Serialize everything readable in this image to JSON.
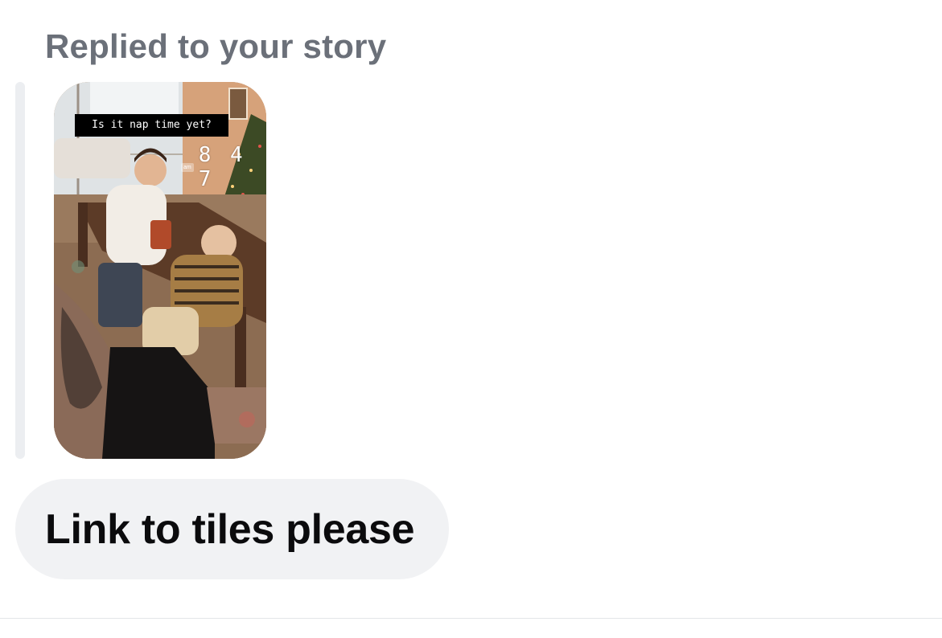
{
  "reply": {
    "header": "Replied to your story"
  },
  "story": {
    "caption": "Is it nap time yet?",
    "clock": {
      "period": "am",
      "time": "8 4 7"
    }
  },
  "message": {
    "text": "Link to tiles please"
  },
  "colors": {
    "header_text": "#6b7079",
    "bubble_bg": "#f1f2f4",
    "bubble_text": "#0b0b0d",
    "quote_bar": "#eceef1"
  }
}
